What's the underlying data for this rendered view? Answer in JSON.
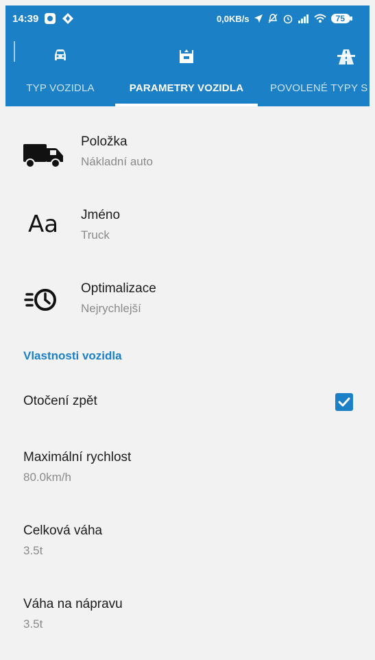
{
  "status_bar": {
    "time": "14:39",
    "network": "0,0KB/s",
    "battery": "75"
  },
  "tabs": [
    {
      "label": "TYP VOZIDLA",
      "icon": "car-icon"
    },
    {
      "label": "PARAMETRY VOZIDLA",
      "icon": "vehicle-parameters-icon"
    },
    {
      "label": "POVOLENÉ TYPY S",
      "icon": "highway-icon"
    }
  ],
  "active_tab_index": 1,
  "items": [
    {
      "title": "Položka",
      "value": "Nákladní auto",
      "icon": "truck-icon"
    },
    {
      "title": "Jméno",
      "value": "Truck",
      "icon_text": "Aa"
    },
    {
      "title": "Optimalizace",
      "value": "Nejrychlejší",
      "icon": "fast-clock-icon"
    }
  ],
  "section": {
    "title": "Vlastnosti vozidla",
    "turnback": {
      "label": "Otočení zpět",
      "checked": true
    },
    "max_speed": {
      "label": "Maximální rychlost",
      "value": "80.0km/h"
    },
    "total_weight": {
      "label": "Celková váha",
      "value": "3.5t"
    },
    "axle_weight": {
      "label": "Váha na nápravu",
      "value": "3.5t"
    }
  },
  "colors": {
    "primary": "#1b80c6",
    "background": "#f2f2f2"
  }
}
